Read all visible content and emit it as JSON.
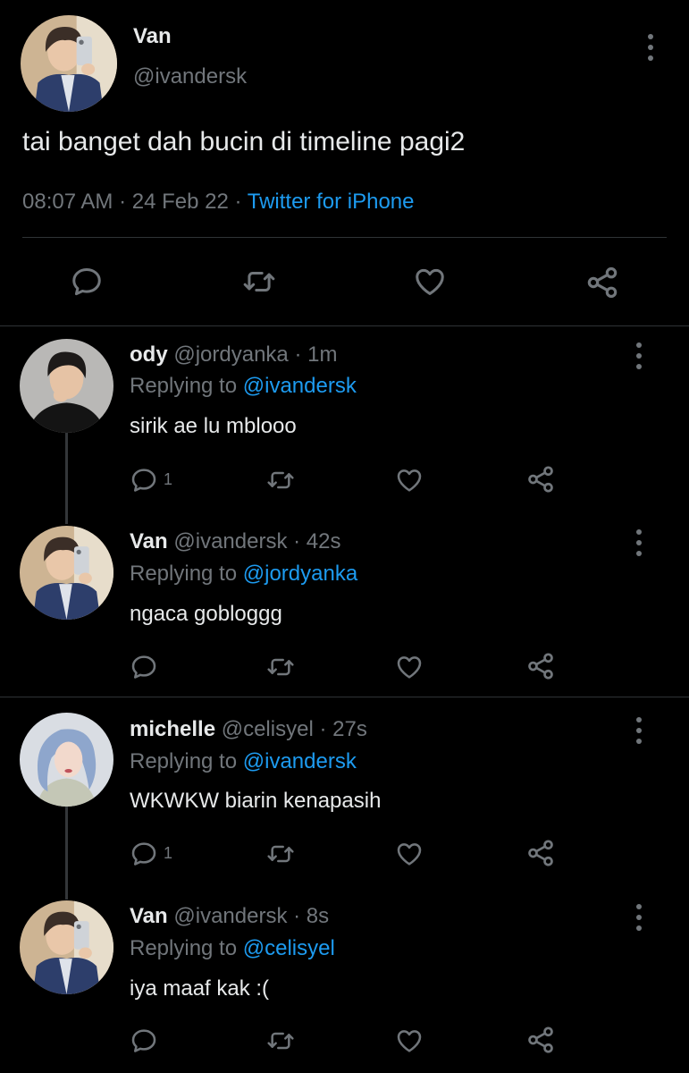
{
  "main_tweet": {
    "display_name": "Van",
    "handle": "@ivandersk",
    "text": "tai banget dah bucin di timeline pagi2",
    "time": "08:07 AM",
    "sep1": "·",
    "date": "24 Feb 22",
    "sep2": "·",
    "source": "Twitter for iPhone"
  },
  "replies": [
    {
      "display_name": "ody",
      "handle": "@jordyanka",
      "sep": "·",
      "time": "1m",
      "replying_prefix": "Replying to",
      "replying_to": "@ivandersk",
      "text": "sirik ae lu mblooo",
      "reply_count": "1"
    },
    {
      "display_name": "Van",
      "handle": "@ivandersk",
      "sep": "·",
      "time": "42s",
      "replying_prefix": "Replying to",
      "replying_to": "@jordyanka",
      "text": "ngaca gobloggg",
      "reply_count": ""
    },
    {
      "display_name": "michelle",
      "handle": "@celisyel",
      "sep": "·",
      "time": "27s",
      "replying_prefix": "Replying to",
      "replying_to": "@ivandersk",
      "text": "WKWKW biarin kenapasih",
      "reply_count": "1"
    },
    {
      "display_name": "Van",
      "handle": "@ivandersk",
      "sep": "·",
      "time": "8s",
      "replying_prefix": "Replying to",
      "replying_to": "@celisyel",
      "text": "iya maaf kak :(",
      "reply_count": ""
    }
  ],
  "icons": {
    "reply": "reply-icon",
    "retweet": "retweet-icon",
    "like": "heart-icon",
    "share": "share-icon",
    "more": "more-icon"
  },
  "colors": {
    "background": "#000000",
    "text": "#e7e9ea",
    "secondary": "#71767b",
    "link": "#1d9bf0"
  }
}
